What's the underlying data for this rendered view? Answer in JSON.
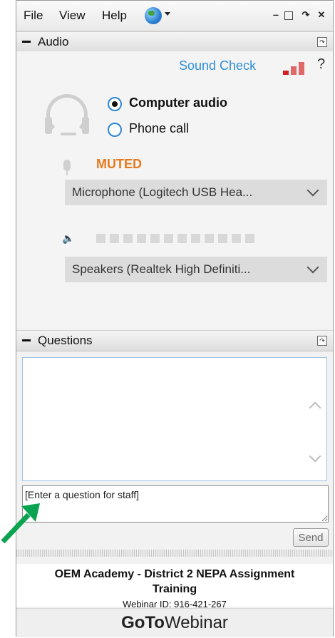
{
  "menubar": {
    "items": [
      "File",
      "View",
      "Help"
    ],
    "globe_icon": "globe-icon",
    "window_buttons": [
      "minimize-icon",
      "maximize-icon",
      "popout-icon",
      "close-icon"
    ]
  },
  "audio": {
    "section_title": "Audio",
    "sound_check": "Sound Check",
    "help_mark": "?",
    "options": [
      {
        "label": "Computer audio",
        "selected": true
      },
      {
        "label": "Phone call",
        "selected": false
      }
    ],
    "mic_status": "MUTED",
    "microphone_select": "Microphone (Logitech USB Hea...",
    "speaker_select": "Speakers (Realtek High Definiti...",
    "speaker_level_segments": 12
  },
  "questions": {
    "section_title": "Questions",
    "input_value": "[Enter a question for staff]",
    "send_label": "Send"
  },
  "info": {
    "title_line1": "OEM Academy - District 2 NEPA Assignment",
    "title_line2": "Training",
    "webinar_id": "Webinar ID: 916-421-267"
  },
  "brand": {
    "goto": "GoTo",
    "webinar": "Webinar"
  },
  "colors": {
    "accent_blue": "#2f8fd8",
    "muted_orange": "#e8791e",
    "annotation_green": "#0aa34f"
  }
}
